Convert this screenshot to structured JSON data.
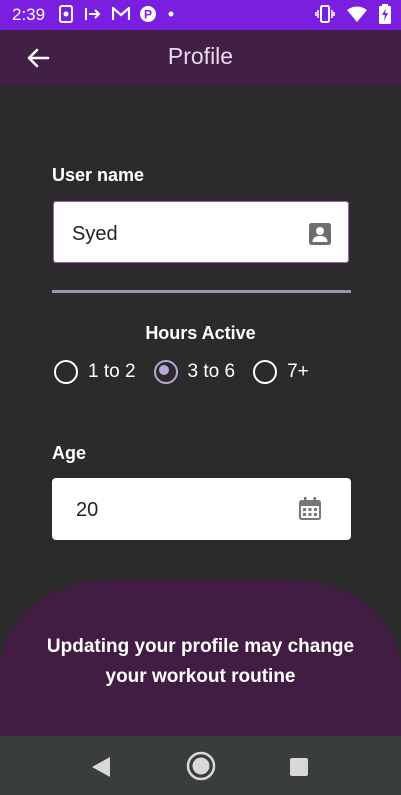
{
  "status_bar": {
    "time": "2:39",
    "icons_left": [
      "phone-clip-icon",
      "arrow-right-bar-icon",
      "gmail-icon",
      "p-icon",
      "dot-icon"
    ],
    "icons_right": [
      "vibrate-icon",
      "wifi-icon",
      "battery-charging-icon"
    ]
  },
  "app_bar": {
    "title": "Profile",
    "back_icon": "arrow-left-icon"
  },
  "form": {
    "username": {
      "label": "User name",
      "value": "Syed",
      "icon": "contact-card-icon"
    },
    "hours_active": {
      "label": "Hours Active",
      "options": [
        {
          "label": "1 to 2",
          "selected": false
        },
        {
          "label": "3 to 6",
          "selected": true
        },
        {
          "label": "7+",
          "selected": false
        }
      ]
    },
    "age": {
      "label": "Age",
      "value": "20",
      "icon": "calendar-icon"
    }
  },
  "notice": {
    "text": "Updating your profile may change your workout routine"
  },
  "nav_bar": {
    "buttons": [
      "back-triangle-icon",
      "home-circle-icon",
      "recents-square-icon"
    ]
  },
  "colors": {
    "status_bar": "#7a1fe0",
    "app_bar": "#421f44",
    "background": "#2b2b2b",
    "card": "#411d43",
    "nav_bar": "#3a3d3d",
    "radio_accent": "#b8a8d8",
    "divider": "#9b93b3"
  }
}
